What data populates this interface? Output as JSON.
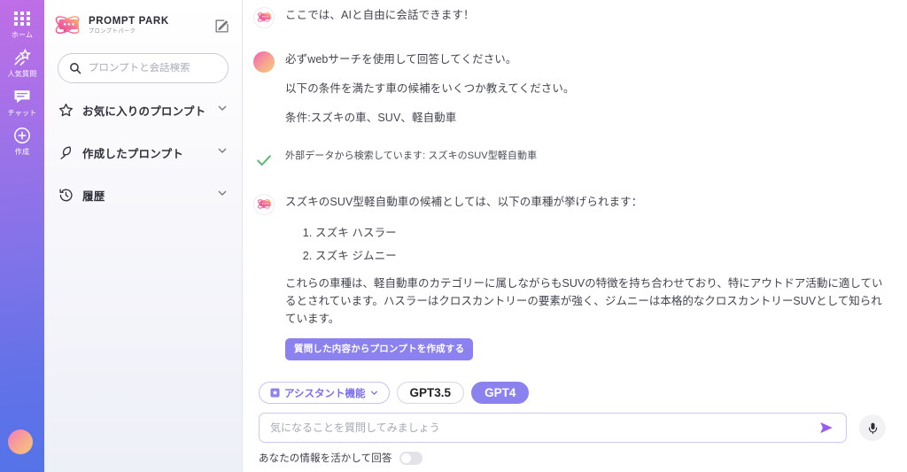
{
  "rail": {
    "items": [
      {
        "label": "ホーム",
        "icon": "grid-icon"
      },
      {
        "label": "人気質問",
        "icon": "shooting-star-icon"
      },
      {
        "label": "チャット",
        "icon": "chat-bubble-icon"
      },
      {
        "label": "作成",
        "icon": "plus-circle-icon"
      }
    ],
    "avatar_icon": "user-avatar"
  },
  "sidebar": {
    "brand": {
      "name": "PROMPT PARK",
      "subtitle": "プロンプトパーク",
      "logo_icon": "prompt-park-logo"
    },
    "edit_icon": "compose-icon",
    "search": {
      "placeholder": "プロンプトと会話検索",
      "value": "",
      "icon": "search-icon"
    },
    "nav": [
      {
        "label": "お気に入りのプロンプト",
        "icon": "star-icon",
        "chevron": "chevron-down-icon"
      },
      {
        "label": "作成したプロンプト",
        "icon": "feather-icon",
        "chevron": "chevron-down-icon"
      },
      {
        "label": "履歴",
        "icon": "history-clock-icon",
        "chevron": "chevron-down-icon"
      }
    ]
  },
  "thread": {
    "intro": {
      "avatar": "bot-avatar",
      "text": "ここでは、AIと自由に会話できます！"
    },
    "user_message": {
      "avatar": "user-avatar",
      "lines": [
        "必ずwebサーチを使用して回答してください。",
        "以下の条件を満たす車の候補をいくつか教えてください。",
        "条件:スズキの車、SUV、軽自動車"
      ]
    },
    "status": {
      "icon": "green-check-icon",
      "text": "外部データから検索しています: スズキのSUV型軽自動車"
    },
    "answer": {
      "avatar": "bot-avatar",
      "intro": "スズキのSUV型軽自動車の候補としては、以下の車種が挙げられます：",
      "list": [
        "スズキ ハスラー",
        "スズキ ジムニー"
      ],
      "summary": "これらの車種は、軽自動車のカテゴリーに属しながらもSUVの特徴を持ち合わせており、特にアウトドア活動に適しているとされています。ハスラーはクロスカントリーの要素が強く、ジムニーは本格的なクロスカントリーSUVとして知られています。",
      "cta_label": "質問した内容からプロンプトを作成する"
    }
  },
  "composer": {
    "assistant_chip": {
      "label": "アシスタント機能",
      "icon": "assistant-icon",
      "chevron": "chevron-down-icon"
    },
    "models": [
      {
        "label": "GPT3.5",
        "active": false
      },
      {
        "label": "GPT4",
        "active": true
      }
    ],
    "input": {
      "placeholder": "気になることを質問してみましょう",
      "value": ""
    },
    "send_icon": "send-arrow-icon",
    "mic_icon": "microphone-icon",
    "personalize": {
      "label": "あなたの情報を活かして回答",
      "state": "off"
    }
  },
  "colors": {
    "accent_purple": "#8b82ef",
    "brand_pink": "#ef5ea3",
    "brand_orange": "#f8cd7a",
    "status_green": "#57b96d",
    "rail_top": "#bf6ee6",
    "rail_bottom": "#5573e8"
  }
}
